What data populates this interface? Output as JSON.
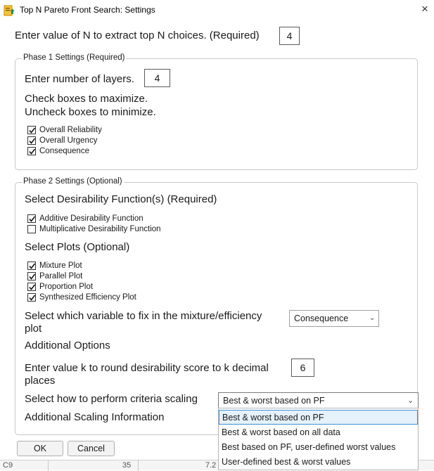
{
  "window": {
    "title": "Top N Pareto Front Search: Settings",
    "close_glyph": "×"
  },
  "top_n": {
    "label": "Enter value of N to extract top N choices. (Required)",
    "value": "4"
  },
  "phase1": {
    "legend": "Phase 1 Settings (Required)",
    "layers_label": "Enter number of layers.",
    "layers_value": "4",
    "instruction_line1": "Check boxes to maximize.",
    "instruction_line2": "Uncheck boxes to minimize.",
    "checkboxes": [
      {
        "label": "Overall Reliability",
        "checked": true
      },
      {
        "label": "Overall Urgency",
        "checked": true
      },
      {
        "label": "Consequence",
        "checked": true
      }
    ]
  },
  "phase2": {
    "legend": "Phase 2 Settings (Optional)",
    "desirability_heading": "Select Desirability Function(s) (Required)",
    "desirability_options": [
      {
        "label": "Additive Desirability Function",
        "checked": true
      },
      {
        "label": "Multiplicative Desirability Function",
        "checked": false
      }
    ],
    "plots_heading": "Select Plots (Optional)",
    "plot_options": [
      {
        "label": "Mixture Plot",
        "checked": true
      },
      {
        "label": "Parallel Plot",
        "checked": true
      },
      {
        "label": "Proportion Plot",
        "checked": true
      },
      {
        "label": "Synthesized Efficiency Plot",
        "checked": true
      }
    ],
    "fix_variable_line1": "Select which variable to fix in the mixture/efficiency",
    "fix_variable_line2": "plot",
    "fix_variable_value": "Consequence",
    "additional_options": "Additional Options",
    "round_line1": "Enter value k to round desirability score to k decimal",
    "round_line2": "places",
    "round_value": "6",
    "scaling_label": "Select how to perform criteria scaling",
    "scaling_value": "Best & worst based on PF",
    "scaling_options": [
      "Best & worst based on PF",
      "Best & worst based on all data",
      "Best based on PF, user-defined worst values",
      "User-defined best & worst values"
    ],
    "additional_scaling": "Additional Scaling Information"
  },
  "buttons": {
    "ok": "OK",
    "cancel": "Cancel"
  },
  "background": {
    "cell_a": "C9",
    "cell_b": "35",
    "cell_c": "7.2"
  },
  "icons": {
    "app": "jmp-script-icon",
    "check": "check-icon",
    "chevron": "chevron-down-icon"
  }
}
